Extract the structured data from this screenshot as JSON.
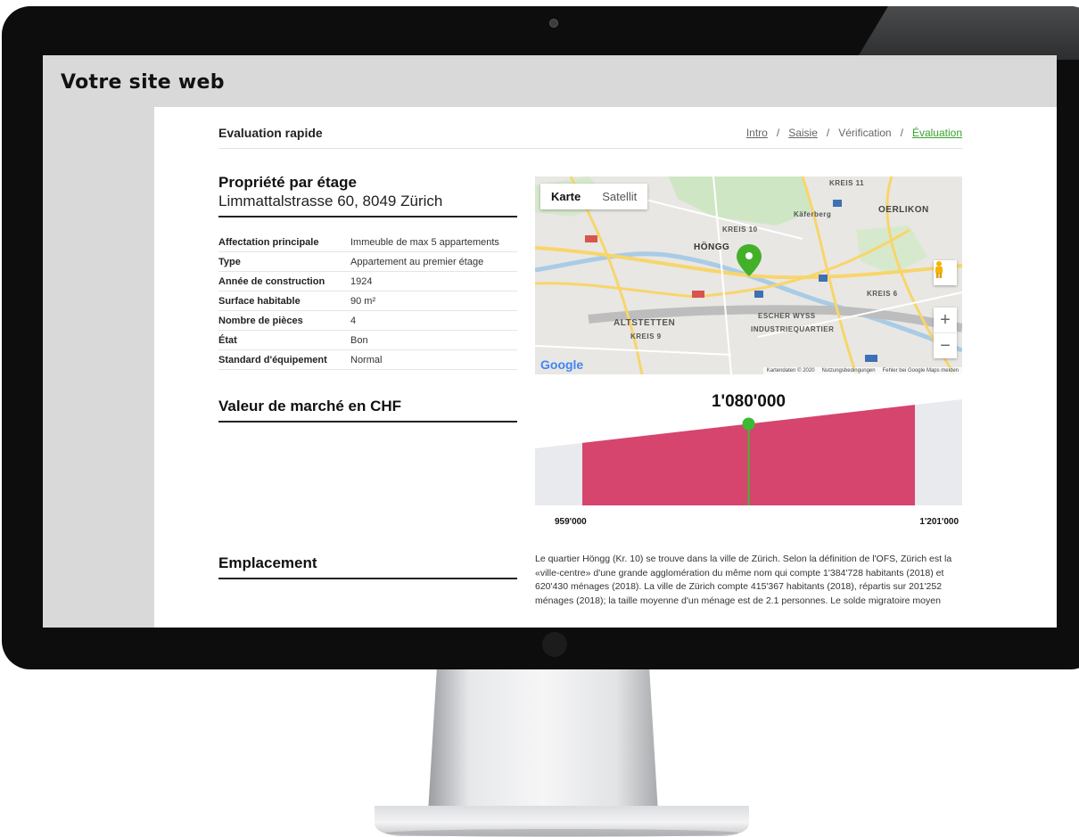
{
  "screen_label": "Votre site web",
  "header": {
    "title": "Evaluation rapide",
    "breadcrumb": [
      {
        "label": "Intro"
      },
      {
        "label": "Saisie"
      },
      {
        "label": "Vérification"
      },
      {
        "label": "Évaluation"
      }
    ],
    "separator": "/"
  },
  "property": {
    "title": "Propriété par étage",
    "address": "Limmattalstrasse 60, 8049 Zürich",
    "rows": [
      {
        "key": "Affectation principale",
        "value": "Immeuble de max 5 appartements"
      },
      {
        "key": "Type",
        "value": "Appartement au premier étage"
      },
      {
        "key": "Année de construction",
        "value": "1924"
      },
      {
        "key": "Surface habitable",
        "value": "90 m²"
      },
      {
        "key": "Nombre de pièces",
        "value": "4"
      },
      {
        "key": "État",
        "value": "Bon"
      },
      {
        "key": "Standard d'équipement",
        "value": "Normal"
      }
    ]
  },
  "map": {
    "tabs": [
      "Karte",
      "Satellit"
    ],
    "active_tab": "Karte",
    "zoom_in": "+",
    "zoom_out": "−",
    "logo": "Google",
    "footer": [
      "Kartendaten © 2020",
      "Nutzungsbedingungen",
      "Fehler bei Google Maps melden"
    ],
    "labels": [
      "KREIS 11",
      "OERLIKON",
      "Käferberg",
      "KREIS 10",
      "HÖNGG",
      "KREIS 6",
      "ESCHER WYSS",
      "ALTSTETTEN",
      "INDUSTRIEQUARTIER",
      "KREIS 9"
    ],
    "pin_color": "#43b02a"
  },
  "market": {
    "heading": "Valeur de marché en CHF",
    "value": "1'080'000",
    "min": "959'000",
    "max": "1'201'000",
    "colors": {
      "band": "#d6456e",
      "marker": "#3cba32",
      "background": "#e8eaed"
    }
  },
  "chart_data": {
    "type": "area",
    "title": "1'080'000",
    "x_range": [
      959000,
      1201000
    ],
    "estimate": 1080000,
    "tick_labels": [
      "959'000",
      "1'201'000"
    ]
  },
  "location": {
    "heading": "Emplacement",
    "text": "Le quartier Höngg (Kr. 10) se trouve dans la ville de Zürich. Selon la définition de l'OFS, Zürich est la «ville-centre» d'une grande agglomération du même nom qui compte 1'384'728 habitants (2018) et 620'430 ménages (2018). La ville de Zürich compte 415'367 habitants (2018), répartis sur 201'252 ménages (2018); la taille moyenne d'un ménage est de 2.1 personnes. Le solde migratoire moyen"
  }
}
